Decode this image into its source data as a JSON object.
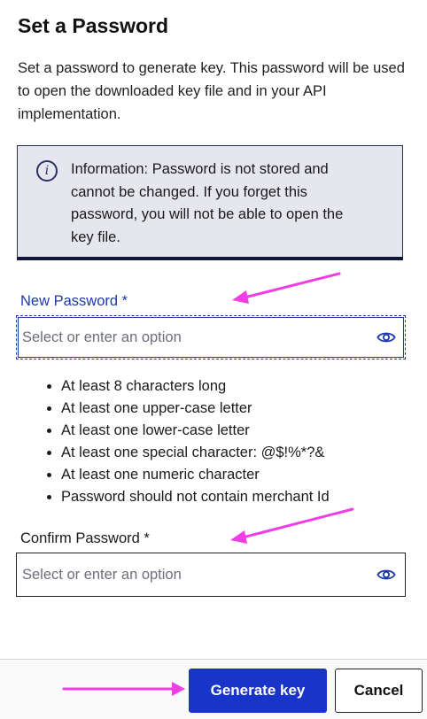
{
  "dialog": {
    "title": "Set a Password",
    "description": "Set a password to generate key. This password will be used to open the downloaded key file and in your API implementation.",
    "info": {
      "icon": "info-icon",
      "icon_glyph": "i",
      "text": "Information: Password is not stored and cannot be changed. If you forget this password, you will not be able to open the key file."
    },
    "new_password": {
      "label": "New Password *",
      "placeholder": "Select or enter an option",
      "value": "",
      "toggle_icon": "eye-icon"
    },
    "rules": [
      "At least 8 characters long",
      "At least one upper-case letter",
      "At least one lower-case letter",
      "At least one special character: @$!%*?&",
      "At least one numeric character",
      "Password should not contain merchant Id"
    ],
    "confirm_password": {
      "label": "Confirm Password *",
      "placeholder": "Select or enter an option",
      "value": "",
      "toggle_icon": "eye-icon"
    },
    "footer": {
      "generate_label": "Generate key",
      "cancel_label": "Cancel"
    }
  },
  "colors": {
    "accent": "#1934c9",
    "label_active": "#1f3aa8",
    "info_background": "#e6e6ee",
    "info_border": "#101738",
    "annotation_arrow": "#f23ce6"
  }
}
